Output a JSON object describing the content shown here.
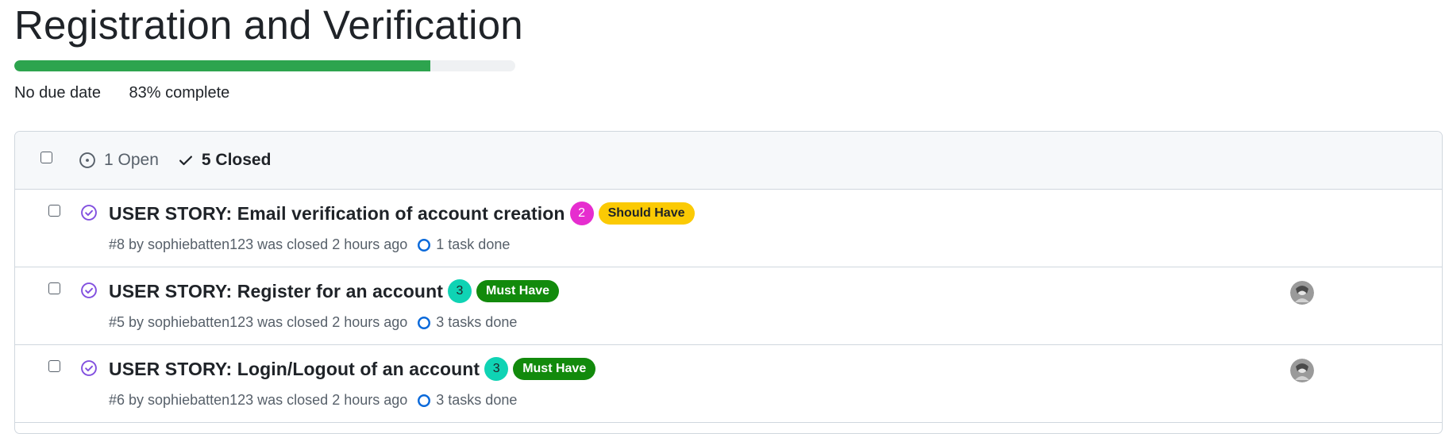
{
  "milestone": {
    "title": "Registration and Verification",
    "progress_fraction": 0.83,
    "due_text": "No due date",
    "percent_text": "83%",
    "complete_word": "complete"
  },
  "filters": {
    "open_label": "1 Open",
    "closed_label": "5 Closed"
  },
  "issues": [
    {
      "title": "USER STORY: Email verification of account creation",
      "points": "2",
      "points_color": "#e62dcf",
      "priority": "Should Have",
      "priority_bg": "#fbca04",
      "priority_fg": "#1f2328",
      "meta": "#8 by sophiebatten123 was closed 2 hours ago",
      "tasks": "1 task done",
      "has_assignee": false
    },
    {
      "title": "USER STORY: Register for an account",
      "points": "3",
      "points_color": "#0fd3b4",
      "priority": "Must Have",
      "priority_bg": "#128a0c",
      "priority_fg": "#ffffff",
      "meta": "#5 by sophiebatten123 was closed 2 hours ago",
      "tasks": "3 tasks done",
      "has_assignee": true
    },
    {
      "title": "USER STORY: Login/Logout of an account",
      "points": "3",
      "points_color": "#0fd3b4",
      "priority": "Must Have",
      "priority_bg": "#128a0c",
      "priority_fg": "#ffffff",
      "meta": "#6 by sophiebatten123 was closed 2 hours ago",
      "tasks": "3 tasks done",
      "has_assignee": true
    }
  ]
}
